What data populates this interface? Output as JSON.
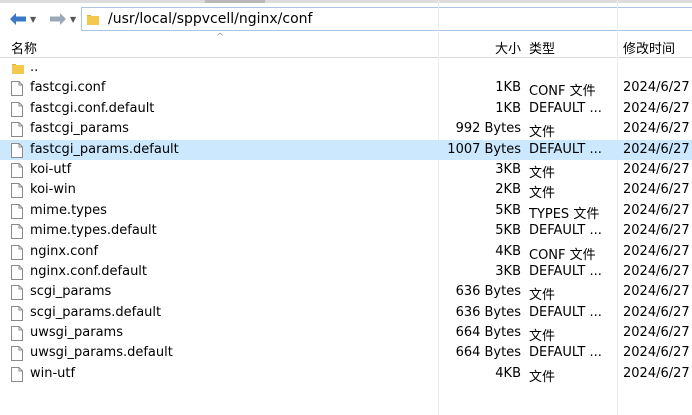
{
  "path_bar": {
    "path": "/usr/local/sppvcell/nginx/conf"
  },
  "columns": {
    "name": "名称",
    "size": "大小",
    "type": "类型",
    "modified": "修改时间"
  },
  "parent_entry": {
    "name": ".."
  },
  "files": [
    {
      "name": "fastcgi.conf",
      "size": "1KB",
      "type": "CONF 文件",
      "modified": "2024/6/27"
    },
    {
      "name": "fastcgi.conf.default",
      "size": "1KB",
      "type": "DEFAULT ...",
      "modified": "2024/6/27"
    },
    {
      "name": "fastcgi_params",
      "size": "992 Bytes",
      "type": "文件",
      "modified": "2024/6/27"
    },
    {
      "name": "fastcgi_params.default",
      "size": "1007 Bytes",
      "type": "DEFAULT ...",
      "modified": "2024/6/27"
    },
    {
      "name": "koi-utf",
      "size": "3KB",
      "type": "文件",
      "modified": "2024/6/27"
    },
    {
      "name": "koi-win",
      "size": "2KB",
      "type": "文件",
      "modified": "2024/6/27"
    },
    {
      "name": "mime.types",
      "size": "5KB",
      "type": "TYPES 文件",
      "modified": "2024/6/27"
    },
    {
      "name": "mime.types.default",
      "size": "5KB",
      "type": "DEFAULT ...",
      "modified": "2024/6/27"
    },
    {
      "name": "nginx.conf",
      "size": "4KB",
      "type": "CONF 文件",
      "modified": "2024/6/27"
    },
    {
      "name": "nginx.conf.default",
      "size": "3KB",
      "type": "DEFAULT ...",
      "modified": "2024/6/27"
    },
    {
      "name": "scgi_params",
      "size": "636 Bytes",
      "type": "文件",
      "modified": "2024/6/27"
    },
    {
      "name": "scgi_params.default",
      "size": "636 Bytes",
      "type": "DEFAULT ...",
      "modified": "2024/6/27"
    },
    {
      "name": "uwsgi_params",
      "size": "664 Bytes",
      "type": "文件",
      "modified": "2024/6/27"
    },
    {
      "name": "uwsgi_params.default",
      "size": "664 Bytes",
      "type": "DEFAULT ...",
      "modified": "2024/6/27"
    },
    {
      "name": "win-utf",
      "size": "4KB",
      "type": "文件",
      "modified": "2024/6/27"
    }
  ],
  "selected_file": "fastcgi_params.default",
  "colors": {
    "selection": "#cce8ff",
    "folder": "#f2c94c",
    "nav_arrow": "#3a78c8"
  }
}
